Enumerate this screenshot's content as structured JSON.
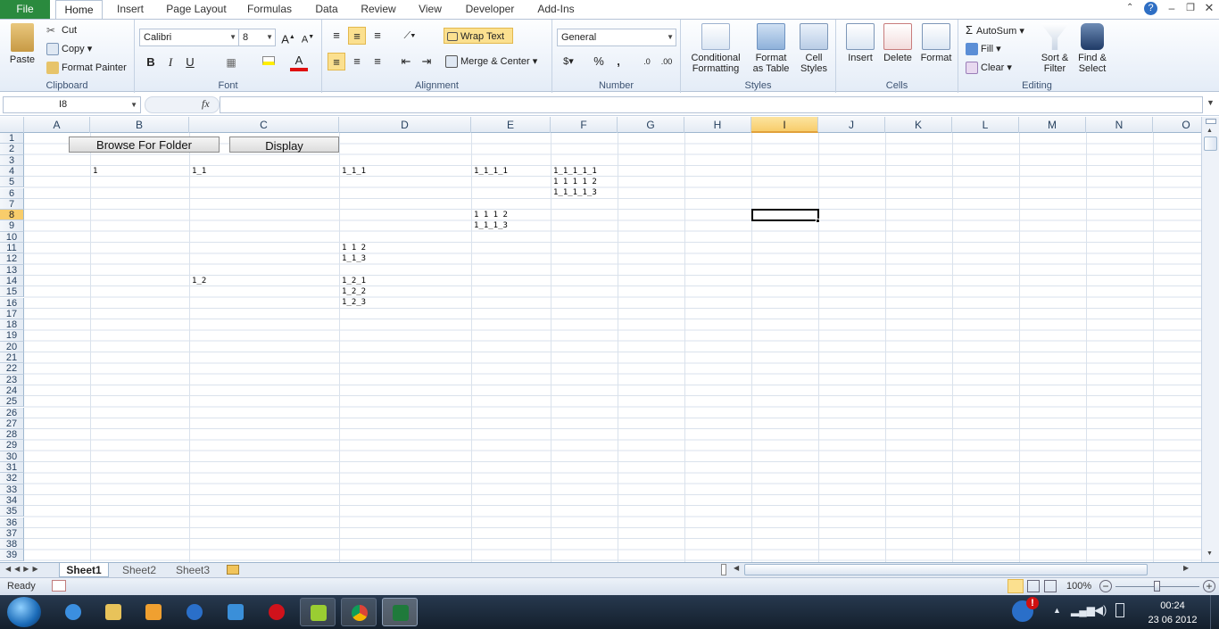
{
  "tabs": [
    "File",
    "Home",
    "Insert",
    "Page Layout",
    "Formulas",
    "Data",
    "Review",
    "View",
    "Developer",
    "Add-Ins"
  ],
  "clipboard": {
    "paste": "Paste",
    "cut": "Cut",
    "copy": "Copy",
    "format_painter": "Format Painter",
    "label": "Clipboard"
  },
  "font": {
    "name": "Calibri",
    "size": "8",
    "bold": "B",
    "italic": "I",
    "underline": "U",
    "label": "Font"
  },
  "alignment": {
    "wrap": "Wrap Text",
    "merge": "Merge & Center",
    "label": "Alignment"
  },
  "number": {
    "format": "General",
    "percent": "%",
    "comma": ",",
    "label": "Number"
  },
  "styles": {
    "conditional": [
      "Conditional",
      "Formatting"
    ],
    "table": [
      "Format",
      "as Table"
    ],
    "cell": [
      "Cell",
      "Styles"
    ],
    "label": "Styles"
  },
  "cells_group": {
    "insert": "Insert",
    "delete": "Delete",
    "format": "Format",
    "label": "Cells"
  },
  "editing": {
    "autosum": "AutoSum",
    "fill": "Fill",
    "clear": "Clear",
    "sort": [
      "Sort &",
      "Filter"
    ],
    "find": [
      "Find &",
      "Select"
    ],
    "label": "Editing"
  },
  "namebox": "I8",
  "fx": "fx",
  "columns": [
    "A",
    "B",
    "C",
    "D",
    "E",
    "F",
    "G",
    "H",
    "I",
    "J",
    "K",
    "L",
    "M",
    "N",
    "O"
  ],
  "selected_column": "I",
  "selected_row": "8",
  "rows": [
    "1",
    "2",
    "3",
    "4",
    "5",
    "6",
    "7",
    "8",
    "9",
    "10",
    "11",
    "12",
    "13",
    "14",
    "15",
    "16",
    "17",
    "18",
    "19",
    "20",
    "21",
    "22",
    "23",
    "24",
    "25",
    "26",
    "27",
    "28",
    "29",
    "30",
    "31",
    "32",
    "33",
    "34",
    "35",
    "36",
    "37",
    "38",
    "39"
  ],
  "buttons": {
    "browse": "Browse For Folder",
    "display": "Display"
  },
  "cells": {
    "B4": "1",
    "C4": "1_1",
    "D4": "1_1_1",
    "E4": "1_1_1_1",
    "F4": "1_1_1_1_1",
    "F5": "1 1 1 1 2",
    "F6": "1_1_1_1_3",
    "E8": "1 1 1 2",
    "E9": "1_1_1_3",
    "D11": "1 1 2",
    "D12": "1_1_3",
    "C14": "1_2",
    "D14": "1_2_1",
    "D15": "1_2_2",
    "D16": "1_2_3"
  },
  "sheets": [
    "Sheet1",
    "Sheet2",
    "Sheet3"
  ],
  "status": {
    "ready": "Ready",
    "zoom": "100%"
  },
  "clock": {
    "time": "00:24",
    "date": "23 06 2012"
  },
  "colors": {
    "file_green": "#2a8a3e",
    "selection": "#f8cd6b",
    "taskbar": "#1c2a3b"
  }
}
